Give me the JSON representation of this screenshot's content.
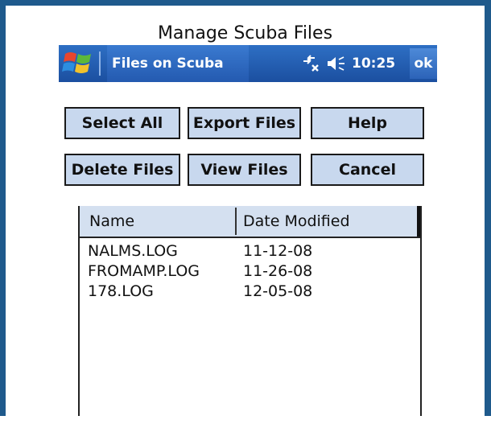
{
  "caption": "Manage Scuba Files",
  "titlebar": {
    "title": "Files on Scuba",
    "time": "10:25",
    "ok_label": "ok",
    "icons": [
      "windows-logo-icon",
      "connectivity-icon",
      "speaker-icon"
    ]
  },
  "buttons": {
    "select_all": "Select All",
    "export_files": "Export Files",
    "help": "Help",
    "delete_files": "Delete Files",
    "view_files": "View Files",
    "cancel": "Cancel"
  },
  "file_list": {
    "columns": [
      "Name",
      "Date Modified"
    ],
    "rows": [
      {
        "name": "NALMS.LOG",
        "date": "11-12-08"
      },
      {
        "name": "FROMAMP.LOG",
        "date": "11-26-08"
      },
      {
        "name": "178.LOG",
        "date": "12-05-08"
      }
    ]
  },
  "colors": {
    "frame": "#1f5a8c",
    "titlebar": "#1b4fa0",
    "button_face": "#c8d8ee",
    "header_face": "#d4e0f0"
  }
}
